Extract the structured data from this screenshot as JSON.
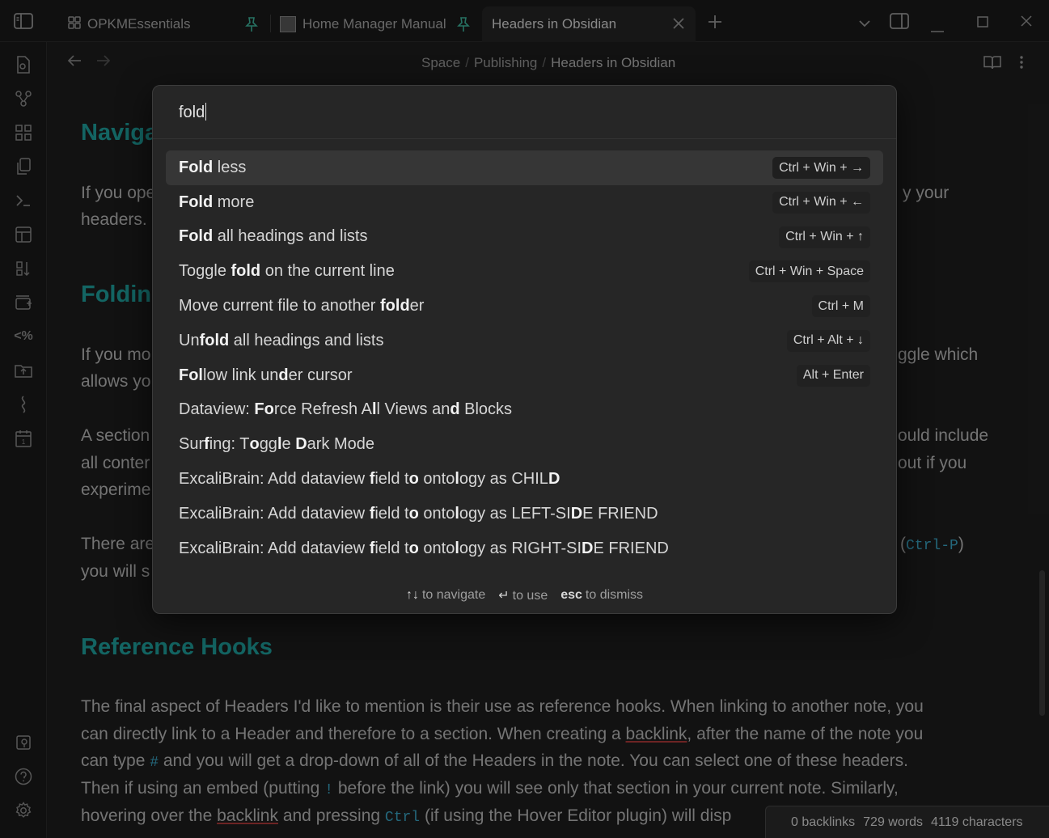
{
  "tabs": [
    {
      "label": "OPKMEssentials",
      "pinned": true,
      "active": false
    },
    {
      "label": "Home Manager Manual",
      "pinned": true,
      "active": false
    },
    {
      "label": "Headers in Obsidian",
      "pinned": false,
      "active": true
    }
  ],
  "breadcrumb": {
    "parts": [
      "Space",
      "Publishing",
      "Headers in Obsidian"
    ],
    "sep": "/"
  },
  "document": {
    "h_nav": "Naviga",
    "p_nav_1": "If you ope",
    "p_nav_1_end": "y your",
    "p_nav_2": "headers.",
    "h_fold": "Foldin",
    "p_fold_1": "If you mo",
    "p_fold_1_end": "ggle which",
    "p_fold_2": "allows yo",
    "p_sec_1": "A section",
    "p_sec_1_end": "ould include",
    "p_sec_2": "all conter",
    "p_sec_2_end": "out if you",
    "p_sec_3": "experime",
    "p_there_1": "There are",
    "p_there_1_open": "(",
    "p_there_1_code": "Ctrl-P",
    "p_there_1_close": ")",
    "p_there_2": "you will s",
    "h_ref": "Reference Hooks",
    "p_ref_1": "The final aspect of Headers I'd like to mention is their use as reference hooks. When linking to another note, you",
    "p_ref_2a": "can directly link to a Header and therefore to a section. When creating a ",
    "p_ref_2_link": "backlink",
    "p_ref_2b": ", after the name of the note you",
    "p_ref_3a": "can type ",
    "p_ref_3_code": "#",
    "p_ref_3b": " and you will get a drop-down of all of the Headers in the note. You can select one of these headers.",
    "p_ref_4a": "Then if using an embed (putting ",
    "p_ref_4_code": "!",
    "p_ref_4b": " before the link) you will see only that section in your current note. Similarly,",
    "p_ref_5a": "hovering over the ",
    "p_ref_5_link": "backlink",
    "p_ref_5b": " and pressing ",
    "p_ref_5_code": "Ctrl",
    "p_ref_5c": " (if using the Hover Editor plugin) will disp"
  },
  "palette": {
    "query": "fold",
    "commands": [
      {
        "label_html": "<b>Fold</b> less",
        "hotkey": "Ctrl + Win + →",
        "selected": true
      },
      {
        "label_html": "<b>Fold</b> more",
        "hotkey": "Ctrl + Win + ←",
        "selected": false
      },
      {
        "label_html": "<b>Fold</b> all headings and lists",
        "hotkey": "Ctrl + Win + ↑",
        "selected": false
      },
      {
        "label_html": "Toggle <b>fold</b> on the current line",
        "hotkey": "Ctrl + Win + Space",
        "selected": false
      },
      {
        "label_html": "Move current file to another <b>fold</b>er",
        "hotkey": "Ctrl + M",
        "selected": false
      },
      {
        "label_html": "Un<b>fold</b> all headings and lists",
        "hotkey": "Ctrl + Alt + ↓",
        "selected": false
      },
      {
        "label_html": "<b>Fol</b>low link un<b>d</b>er cursor",
        "hotkey": "Alt + Enter",
        "selected": false
      },
      {
        "label_html": "Dataview: <b>Fo</b>rce Refresh A<b>l</b>l Views an<b>d</b> Blocks",
        "hotkey": "",
        "selected": false
      },
      {
        "label_html": "Sur<b>f</b>ing: T<b>o</b>gg<b>l</b>e <b>D</b>ark Mode",
        "hotkey": "",
        "selected": false
      },
      {
        "label_html": "ExcaliBrain: Add dataview <b>f</b>ield t<b>o</b> onto<b>l</b>ogy as CHIL<b>D</b>",
        "hotkey": "",
        "selected": false
      },
      {
        "label_html": "ExcaliBrain: Add dataview <b>f</b>ield t<b>o</b> onto<b>l</b>ogy as LEFT-SI<b>D</b>E FRIEND",
        "hotkey": "",
        "selected": false
      },
      {
        "label_html": "ExcaliBrain: Add dataview <b>f</b>ield t<b>o</b> onto<b>l</b>ogy as RIGHT-SI<b>D</b>E FRIEND",
        "hotkey": "",
        "selected": false
      }
    ],
    "footer": {
      "nav_key": "↑↓",
      "nav_text": "to navigate",
      "use_key": "↵",
      "use_text": "to use",
      "esc_key": "esc",
      "esc_text": "to dismiss"
    }
  },
  "status": {
    "backlinks": "0 backlinks",
    "words": "729 words",
    "chars": "4119 characters"
  },
  "icons": {
    "sidebar_toggle": "sidebar-toggle-icon",
    "pin": "pin-icon",
    "close": "close-icon",
    "new_tab": "plus-icon",
    "tab_list": "chevron-down-icon",
    "right_sidebar": "right-sidebar-icon",
    "minimize": "minimize-icon",
    "maximize": "maximize-icon",
    "win_close": "window-close-icon"
  },
  "colors": {
    "accent": "#1fa3a0",
    "pin": "#3fb8a0",
    "code": "#3aa8c9"
  }
}
